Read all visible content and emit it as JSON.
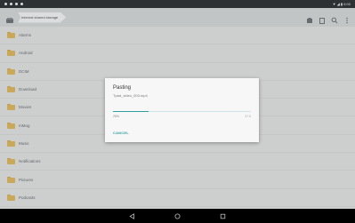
{
  "status_bar": {
    "time": "",
    "icons": [
      "notification-icon",
      "notification-icon",
      "notification-icon",
      "notification-icon"
    ],
    "right_text": "▼ ◢ ▮ 6:00"
  },
  "toolbar": {
    "home_icon": "storage-home-icon",
    "breadcrumb": "Internal shared storage",
    "actions": [
      "paste-icon",
      "clipboard-icon",
      "search-icon",
      "more-icon"
    ]
  },
  "folders": [
    {
      "label": "Alarms"
    },
    {
      "label": "Android"
    },
    {
      "label": "DCIM"
    },
    {
      "label": "Download"
    },
    {
      "label": "Movies"
    },
    {
      "label": "mMog"
    },
    {
      "label": "Music"
    },
    {
      "label": "Notifications"
    },
    {
      "label": "Pictures"
    },
    {
      "label": "Podcasts"
    }
  ],
  "dialog": {
    "title": "Pasting",
    "file_name": "Tpad_video_003.mp4",
    "progress_fraction": 0.26,
    "percent_text": "26%",
    "count_text": "1 / 1",
    "cancel_label": "CANCEL"
  },
  "nav_bar": {
    "icons": [
      "back-icon",
      "home-icon",
      "recents-icon"
    ]
  },
  "colors": {
    "accent": "#2e9e9e",
    "folder": "#d6b45f",
    "toolbar": "#cfd2d3",
    "list_bg": "#dadcdc"
  }
}
